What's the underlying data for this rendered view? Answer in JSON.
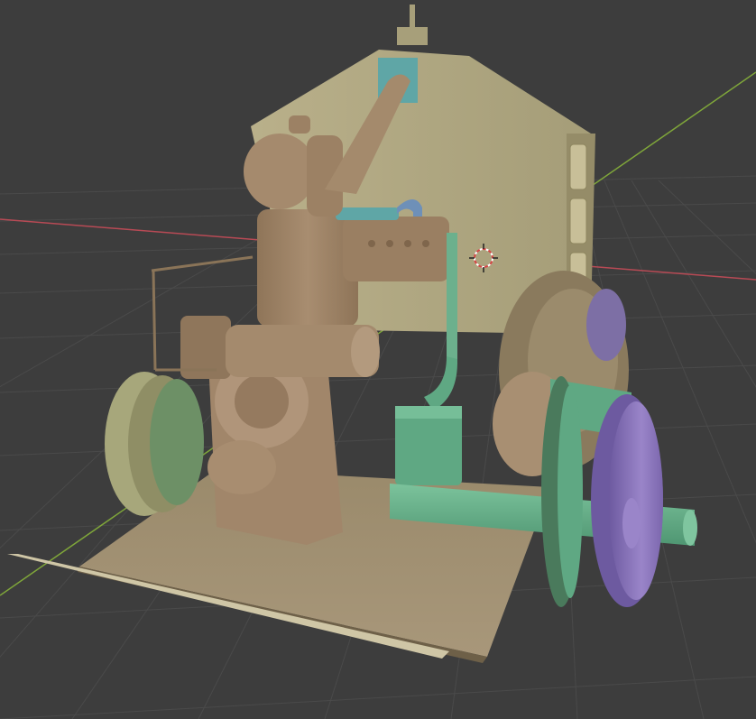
{
  "viewport": {
    "background": "#3d3d3d",
    "grid_color": "#4c4c4c",
    "axis_x_color": "#b84a55",
    "axis_y_color": "#7fa63a",
    "cursor_icon": "3d-cursor-icon"
  },
  "model": {
    "body_color": "#a0866a",
    "housing_color": "#a79f7a",
    "floor_color": "#9d8c6c",
    "pipe_color": "#5fa883",
    "flywheel_color": "#8d78bd",
    "wheel_color": "#a7a77b",
    "accent_blue": "#6e90b8",
    "accent_teal": "#5fa6a6"
  }
}
